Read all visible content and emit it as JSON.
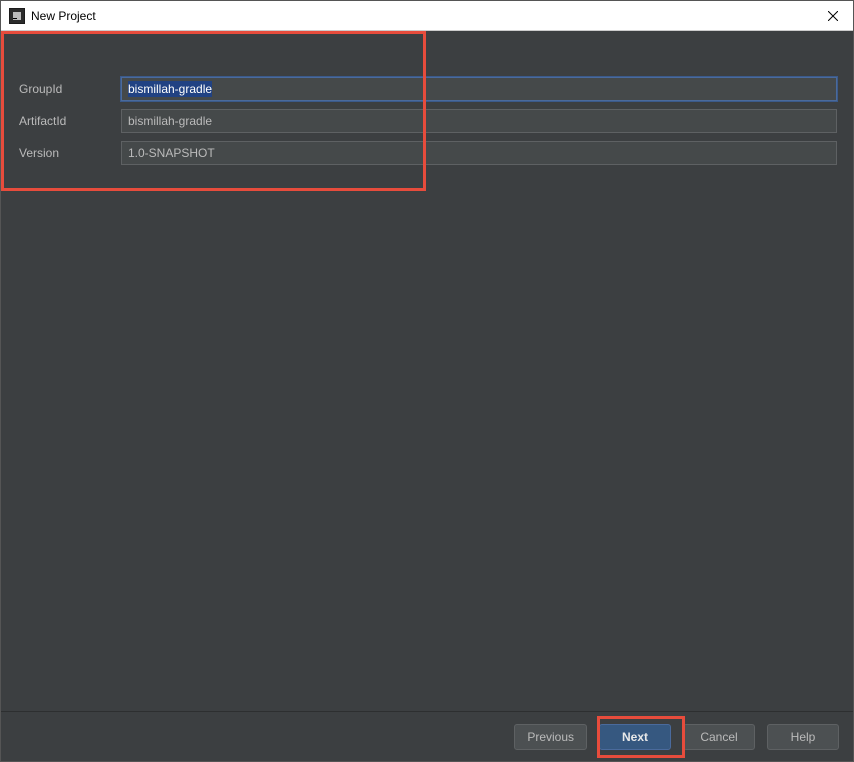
{
  "titlebar": {
    "title": "New Project"
  },
  "form": {
    "groupId": {
      "label": "GroupId",
      "value": "bismillah-gradle"
    },
    "artifactId": {
      "label": "ArtifactId",
      "value": "bismillah-gradle"
    },
    "version": {
      "label": "Version",
      "value": "1.0-SNAPSHOT"
    }
  },
  "buttons": {
    "previous": "Previous",
    "next": "Next",
    "cancel": "Cancel",
    "help": "Help"
  }
}
